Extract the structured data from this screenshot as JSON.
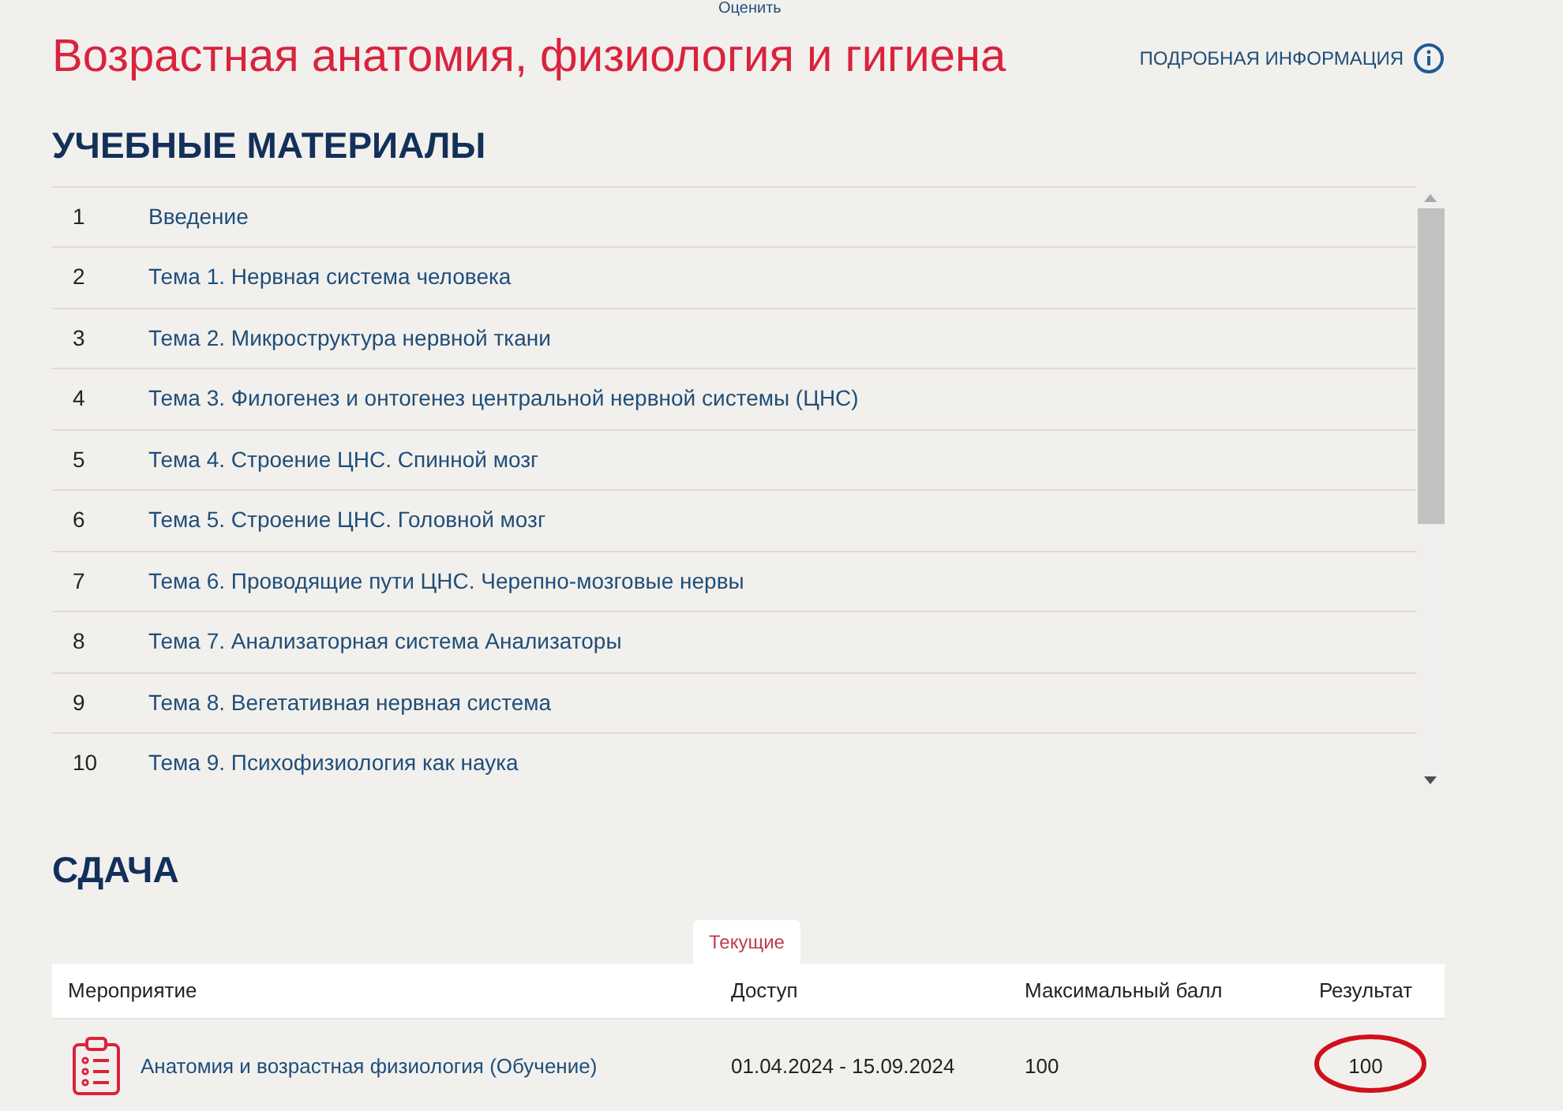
{
  "top_link": "Оценить",
  "title": "Возрастная анатомия, физиология и гигиена",
  "info_link": "ПОДРОБНАЯ ИНФОРМАЦИЯ",
  "materials": {
    "heading": "УЧЕБНЫЕ МАТЕРИАЛЫ",
    "rows": [
      {
        "number": "1",
        "title": "Введение"
      },
      {
        "number": "2",
        "title": "Тема 1. Нервная система человека"
      },
      {
        "number": "3",
        "title": "Тема 2. Микроструктура нервной ткани"
      },
      {
        "number": "4",
        "title": "Тема 3. Филогенез и онтогенез центральной нервной системы (ЦНС)"
      },
      {
        "number": "5",
        "title": "Тема 4. Строение ЦНС. Спинной мозг"
      },
      {
        "number": "6",
        "title": "Тема 5. Строение ЦНС. Головной мозг"
      },
      {
        "number": "7",
        "title": "Тема 6. Проводящие пути ЦНС. Черепно-мозговые нервы"
      },
      {
        "number": "8",
        "title": "Тема 7. Анализаторная система Анализаторы"
      },
      {
        "number": "9",
        "title": "Тема 8. Вегетативная нервная система"
      },
      {
        "number": "10",
        "title": "Тема 9. Психофизиология как наука"
      }
    ]
  },
  "submission": {
    "heading": "СДАЧА",
    "tabs": [
      {
        "label": "Текущие",
        "selected": true
      }
    ],
    "columns": [
      "Мероприятие",
      "Доступ",
      "Максимальный балл",
      "Результат"
    ],
    "rows": [
      {
        "activity": "Анатомия и возрастная физиология (Обучение)",
        "access": "01.04.2024 - 15.09.2024",
        "max_score": "100",
        "result": "100",
        "result_circled": true
      }
    ]
  }
}
